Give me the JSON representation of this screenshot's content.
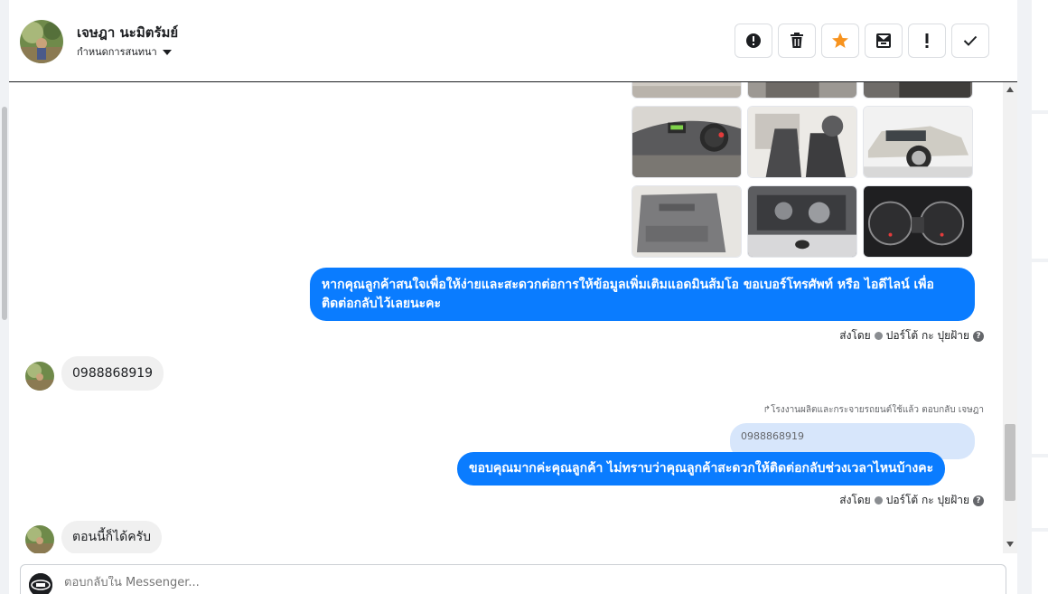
{
  "header": {
    "contact_name": "เจษฎา นะมิตรัมย์",
    "subtitle": "กำหนดการสนทนา",
    "toolbar": [
      {
        "name": "report-button",
        "icon": "alert-circle-icon"
      },
      {
        "name": "delete-button",
        "icon": "trash-icon"
      },
      {
        "name": "star-button",
        "icon": "star-icon"
      },
      {
        "name": "move-to-inbox-button",
        "icon": "inbox-icon"
      },
      {
        "name": "mark-important-button",
        "icon": "exclamation-icon"
      },
      {
        "name": "mark-done-button",
        "icon": "check-icon"
      }
    ]
  },
  "messages": {
    "out_1": "หากคุณลูกค้าสนใจเพื่อให้ง่ายและสะดวกต่อการให้ข้อมูลเพิ่มเติมแอดมินส้มโอ ขอเบอร์โทรศัพท์ หรือ ไอดีไลน์ เพื่อติดต่อกลับไว้เลยนะคะ",
    "sent_by_1": "ส่งโดย",
    "sender_1": "ปอร์โต้ กะ ปุยฝ้าย",
    "in_1": "0988868919",
    "reply_meta": "โรงงานผลิตและกระจายรถยนต์ใช้แล้ว ตอบกลับ เจษฎา",
    "quoted_text": "0988868919",
    "out_2": "ขอบคุณมากค่ะคุณลูกค้า ไม่ทราบว่าคุณลูกค้าสะดวกให้ติดต่อกลับช่วงเวลาไหนบ้างคะ",
    "sent_by_2": "ส่งโดย",
    "sender_2": "ปอร์โต้ กะ ปุยฝ้าย",
    "in_2": "ตอนนี้ก็ได้ครับ"
  },
  "composer": {
    "placeholder": "ตอบกลับใน Messenger..."
  },
  "colors": {
    "outgoing_bubble": "#0a7cff",
    "incoming_bubble": "#f0f0f0",
    "star": "#f7931e"
  }
}
